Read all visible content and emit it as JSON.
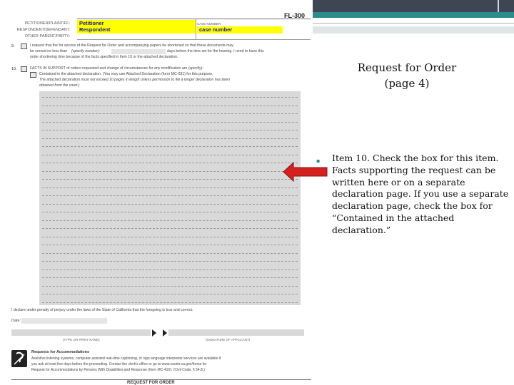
{
  "slide": {
    "title_line1": "Request for Order",
    "title_line2": "(page 4)",
    "bullet": "Item 10.  Check the box for this item.  Facts supporting the request can be written here or on a separate declaration page.  If you use a separate declaration page, check the box for “Contained in the attached declaration.”"
  },
  "form": {
    "code": "FL-300",
    "header": {
      "petitioner_label": "PETITIONER/PLAINTIFF:",
      "petitioner_value": "Petitioner",
      "respondent_label": "RESPONDENT/DEFENDANT:",
      "respondent_value": "Respondent",
      "other_label": "OTHER PARENT/PARTY:",
      "case_number_label": "CASE NUMBER:",
      "case_number_value": "case number"
    },
    "item9": {
      "number": "9.",
      "line1": "I request that the for service of the Request for Order and accompanying papers be shortened so that these documents may",
      "line2a": "be served no less than",
      "line2b": "(specify number):",
      "line2c": "days before the time set for the hearing.  I need to have this",
      "line3": "order shortening time because of the facts specified in Item 10 or the attached declaration."
    },
    "item10": {
      "number": "10.",
      "line1": "FACTS IN SUPPORT of orders requested and change of circumstances for any modification are (specify):",
      "line2": "Contained in the attached declaration.  (You may use Attached Declaration (form MC-031) for this purpose.",
      "line3": "The attached declaration must not exceed 10 pages in length unless permission to file a longer declaration has been",
      "line4": "obtained from the court.)"
    },
    "declaration": "I declare under penalty of perjury under the laws of the State of California that the foregoing is true and correct.",
    "date_label": "Date:",
    "name_caption": "(TYPE OR PRINT NAME)",
    "signature_caption": "(SIGNATURE OF APPLICANT)",
    "accommodations": {
      "title": "Requests for Accommodations",
      "line1": "Assistive listening systems, computer-assisted real-time captioning, or sign language interpreter services are available if",
      "line2": "you ask at least five days before the proceeding.  Contact the clerk's office or go to www.courts.ca.gov/forms for",
      "line3": "Request for Accommodations by Persons With Disabilities and Response (form MC-410). (Civil Code, § 54.8.)"
    },
    "footer_title": "REQUEST FOR ORDER"
  },
  "colors": {
    "highlight_yellow": "#ffff00",
    "arrow_red": "#d42020",
    "accent_teal": "#2c8c8e",
    "topbar_dark": "#3e4654"
  }
}
